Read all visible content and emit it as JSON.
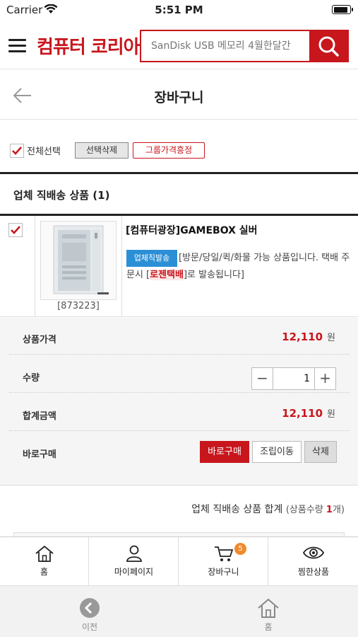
{
  "status": {
    "carrier": "Carrier",
    "time": "5:51 PM"
  },
  "header": {
    "logo": "컴퓨터 코리아",
    "search_placeholder": "SanDisk USB 메모리 4월한달간"
  },
  "subheader": {
    "title": "장바구니"
  },
  "selection": {
    "select_all_label": "전체선택",
    "delete_selected_label": "선택삭제",
    "group_price_label": "그룹가격흥정"
  },
  "section": {
    "title": "업체 직배송 상품",
    "count": "1"
  },
  "product": {
    "code": "[873223]",
    "name": "[컴퓨터광장]GAMEBOX 실버",
    "ship_badge": "업체직발송",
    "ship_desc_1": "[방문/당일/퀵/화물 가능 상품입니다. 택배 주문시 [",
    "ship_courier": "로젠택배",
    "ship_desc_2": "]로 발송됩니다]"
  },
  "details": {
    "price_label": "상품가격",
    "price_value": "12,110",
    "currency": "원",
    "qty_label": "수량",
    "qty_value": "1",
    "minus": "−",
    "plus": "+",
    "total_label": "합계금액",
    "total_value": "12,110",
    "buy_label": "바로구매",
    "buy_button": "바로구매",
    "assemble_button": "조립이동",
    "delete_button": "삭제"
  },
  "summary": {
    "title": "업체 직배송 상품 합계",
    "sub_prefix": "(상품수량 ",
    "sub_count": "1",
    "sub_suffix": "개)"
  },
  "tabbar": [
    {
      "label": "홈",
      "icon": "home-icon"
    },
    {
      "label": "마이페이지",
      "icon": "person-icon"
    },
    {
      "label": "장바구니",
      "icon": "cart-icon",
      "badge": "5"
    },
    {
      "label": "찜한상품",
      "icon": "eye-icon"
    }
  ],
  "browserbar": {
    "back_label": "이전",
    "home_label": "홈"
  },
  "colors": {
    "brand_red": "#c8161d",
    "badge_blue": "#2b8fd6",
    "badge_orange": "#f08a2a"
  }
}
